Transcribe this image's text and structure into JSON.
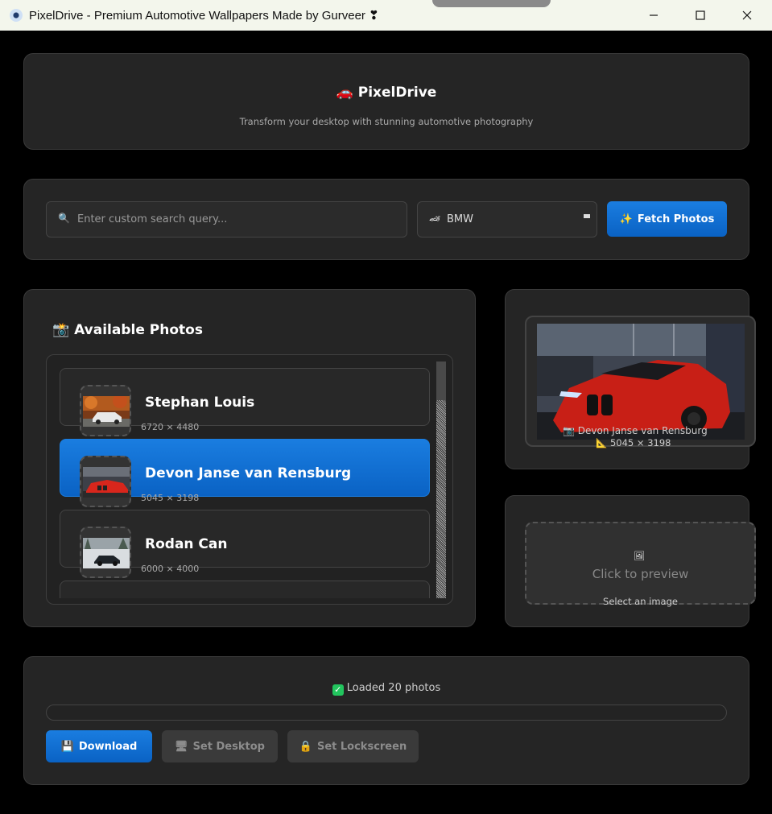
{
  "window": {
    "title": "PixelDrive - Premium Automotive Wallpapers Made by Gurveer ❣",
    "minimize_icon": "minimize-icon",
    "maximize_icon": "maximize-icon",
    "close_icon": "close-icon"
  },
  "header": {
    "logo_emoji": "🚗",
    "title": "PixelDrive",
    "subtitle": "Transform your desktop with stunning automotive photography"
  },
  "search": {
    "icon": "🔍",
    "placeholder": "Enter custom search query...",
    "value": "",
    "brand_icon": "🏎",
    "brand_selected": "BMW",
    "fetch_icon": "✨",
    "fetch_label": "Fetch Photos"
  },
  "photos": {
    "header_icon": "📸",
    "header": "Available Photos",
    "items": [
      {
        "name": "Stephan Louis",
        "resolution": "6720 × 4480",
        "selected": false
      },
      {
        "name": "Devon Janse van Rensburg",
        "resolution": "5045 × 3198",
        "selected": true
      },
      {
        "name": "Rodan Can",
        "resolution": "6000 × 4000",
        "selected": false
      }
    ]
  },
  "preview": {
    "camera_icon": "📷",
    "photographer": "Devon Janse van Rensburg",
    "ruler_icon": "📐",
    "resolution": "5045 × 3198"
  },
  "placeholder": {
    "icon": "🖼",
    "title": "Click to preview",
    "subtitle": "Select an image"
  },
  "status": {
    "check_icon": "✅",
    "text": "Loaded 20 photos",
    "progress": 0
  },
  "actions": {
    "download_icon": "💾",
    "download": "Download",
    "desktop_icon": "🖥",
    "desktop": "Set Desktop",
    "lockscreen_icon": "🔒",
    "lockscreen": "Set Lockscreen"
  },
  "colors": {
    "accent": "#0a6fd8",
    "panel": "#252525",
    "background": "#000000",
    "success": "#2ecc71"
  }
}
